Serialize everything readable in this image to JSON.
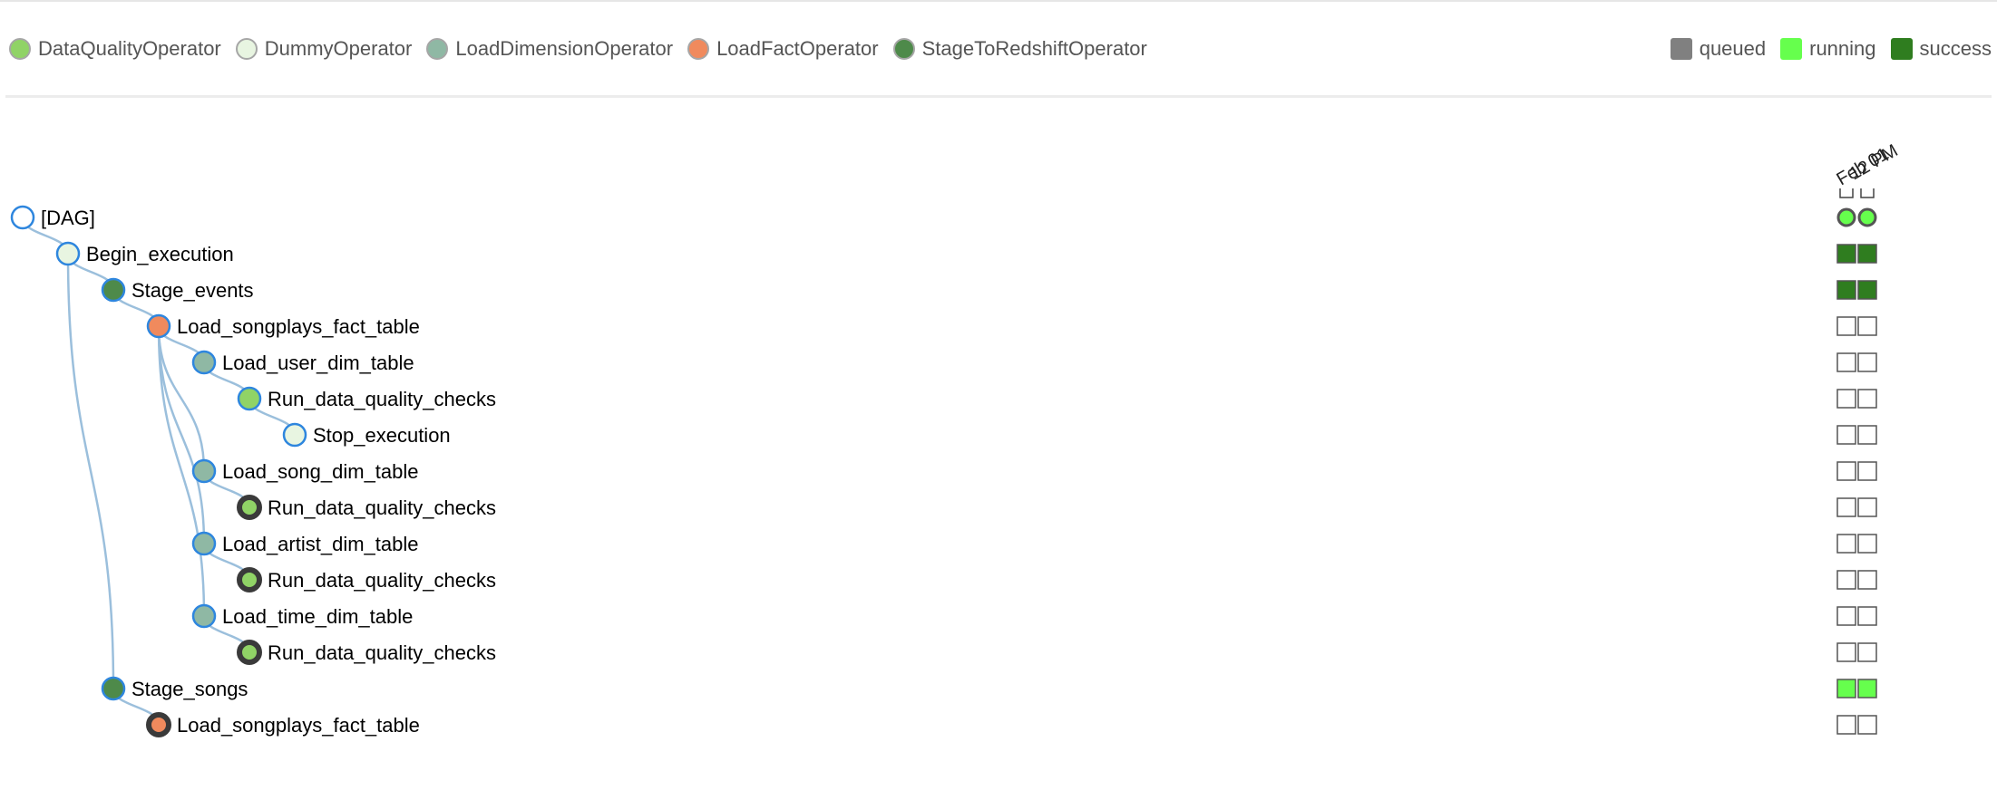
{
  "operators": [
    {
      "name": "DataQualityOperator",
      "color": "#90d366"
    },
    {
      "name": "DummyOperator",
      "color": "#e8f5e1"
    },
    {
      "name": "LoadDimensionOperator",
      "color": "#8fb8a4"
    },
    {
      "name": "LoadFactOperator",
      "color": "#f08a5d"
    },
    {
      "name": "StageToRedshiftOperator",
      "color": "#4e8a4a"
    }
  ],
  "states": [
    {
      "name": "queued",
      "color": "#808080"
    },
    {
      "name": "running",
      "color": "#66ff4d"
    },
    {
      "name": "success",
      "color": "#2f7d1f"
    }
  ],
  "dates": [
    "Feb 01",
    "12 PM"
  ],
  "tasks": [
    {
      "label": "[DAG]",
      "depth": 0,
      "operator": "DAG",
      "run_states": [
        "running",
        "running"
      ]
    },
    {
      "label": "Begin_execution",
      "depth": 1,
      "operator": "DummyOperator",
      "run_states": [
        "success",
        "success"
      ]
    },
    {
      "label": "Stage_events",
      "depth": 2,
      "operator": "StageToRedshiftOperator",
      "run_states": [
        "success",
        "success"
      ]
    },
    {
      "label": "Load_songplays_fact_table",
      "depth": 3,
      "operator": "LoadFactOperator",
      "run_states": [
        "none",
        "none"
      ]
    },
    {
      "label": "Load_user_dim_table",
      "depth": 4,
      "operator": "LoadDimensionOperator",
      "run_states": [
        "none",
        "none"
      ]
    },
    {
      "label": "Run_data_quality_checks",
      "depth": 5,
      "operator": "DataQualityOperator",
      "run_states": [
        "none",
        "none"
      ]
    },
    {
      "label": "Stop_execution",
      "depth": 6,
      "operator": "DummyOperator",
      "run_states": [
        "none",
        "none"
      ]
    },
    {
      "label": "Load_song_dim_table",
      "depth": 4,
      "operator": "LoadDimensionOperator",
      "run_states": [
        "none",
        "none"
      ]
    },
    {
      "label": "Run_data_quality_checks",
      "depth": 5,
      "operator": "DataQualityOperator",
      "collapsed": true,
      "run_states": [
        "none",
        "none"
      ]
    },
    {
      "label": "Load_artist_dim_table",
      "depth": 4,
      "operator": "LoadDimensionOperator",
      "run_states": [
        "none",
        "none"
      ]
    },
    {
      "label": "Run_data_quality_checks",
      "depth": 5,
      "operator": "DataQualityOperator",
      "collapsed": true,
      "run_states": [
        "none",
        "none"
      ]
    },
    {
      "label": "Load_time_dim_table",
      "depth": 4,
      "operator": "LoadDimensionOperator",
      "run_states": [
        "none",
        "none"
      ]
    },
    {
      "label": "Run_data_quality_checks",
      "depth": 5,
      "operator": "DataQualityOperator",
      "collapsed": true,
      "run_states": [
        "none",
        "none"
      ]
    },
    {
      "label": "Stage_songs",
      "depth": 2,
      "operator": "StageToRedshiftOperator",
      "run_states": [
        "running",
        "running"
      ]
    },
    {
      "label": "Load_songplays_fact_table",
      "depth": 3,
      "operator": "LoadFactOperator",
      "collapsed": true,
      "run_states": [
        "none",
        "none"
      ]
    }
  ]
}
